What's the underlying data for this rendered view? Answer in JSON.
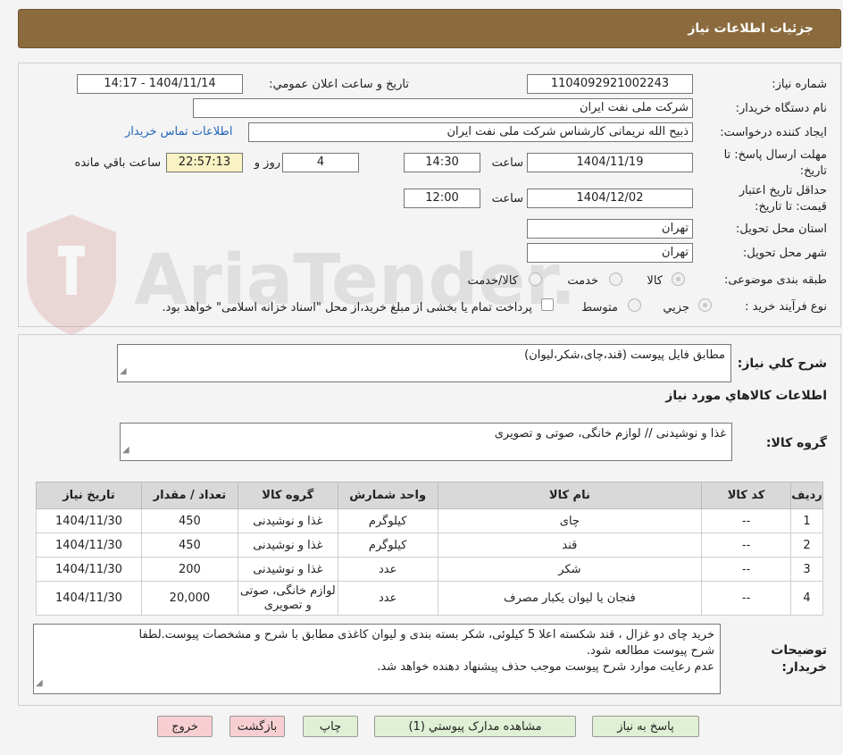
{
  "header": {
    "title": "جزئیات اطلاعات نیاز"
  },
  "watermark": {
    "text": "AriaTender.net"
  },
  "fields": {
    "need_number_label": "شماره نیاز:",
    "need_number": "1104092921002243",
    "announce_label": "تاریخ و ساعت اعلان عمومي:",
    "announce_value": "1404/11/14 - 14:17",
    "buyer_org_label": "نام دستگاه خريدار:",
    "buyer_org": "شرکت ملی نفت ایران",
    "creator_label": "ايجاد کننده درخواست:",
    "creator": "ذبیح الله نریمانی کارشناس شرکت ملی نفت ایران",
    "contact_link": "اطلاعات تماس خريدار",
    "reply_deadline_label_1": "مهلت ارسال پاسخ: تا",
    "reply_deadline_label_2": "تاریخ:",
    "reply_date": "1404/11/19",
    "time_label": "ساعت",
    "reply_time": "14:30",
    "days_value": "4",
    "days_label": "روز و",
    "remaining_time": "22:57:13",
    "remaining_label": "ساعت باقي مانده",
    "price_valid_label_1": "حداقل تاریخ اعتبار",
    "price_valid_label_2": "قیمت: تا تاریخ:",
    "price_valid_date": "1404/12/02",
    "price_valid_time": "12:00",
    "province_label": "استان محل تحویل:",
    "province": "تهران",
    "city_label": "شهر محل تحویل:",
    "city": "تهران",
    "category_label": "طبقه بندی موضوعی:",
    "category_options": [
      "کالا",
      "خدمت",
      "کالا/خدمت"
    ],
    "category_selected": "کالا",
    "process_label": "نوع فرآیند خرید :",
    "process_options": [
      "جزيي",
      "متوسط"
    ],
    "process_selected": "جزيي",
    "payment_note": "پرداخت تمام یا بخشی از مبلغ خرید،از محل \"اسناد خزانه اسلامی\" خواهد بود."
  },
  "summary": {
    "label": "شرح کلي نياز:",
    "value": "مطابق فایل پیوست (قند،چای،شکر،لیوان)"
  },
  "goods_info_title": "اطلاعات کالاهاي مورد نياز",
  "goods_group": {
    "label": "گروه کالا:",
    "value": "غذا و نوشیدنی // لوازم خانگی، صوتی و تصویری"
  },
  "table": {
    "headers": [
      "رديف",
      "کد کالا",
      "نام کالا",
      "واحد شمارش",
      "گروه کالا",
      "تعداد / مقدار",
      "تاریخ نیاز"
    ],
    "rows": [
      [
        "1",
        "--",
        "چای",
        "کیلوگرم",
        "غذا و نوشیدنی",
        "450",
        "1404/11/30"
      ],
      [
        "2",
        "--",
        "قند",
        "کیلوگرم",
        "غذا و نوشیدنی",
        "450",
        "1404/11/30"
      ],
      [
        "3",
        "--",
        "شکر",
        "عدد",
        "غذا و نوشیدنی",
        "200",
        "1404/11/30"
      ],
      [
        "4",
        "--",
        "فنجان یا لیوان یکبار مصرف",
        "عدد",
        "لوازم خانگی، صوتی و تصویری",
        "20,000",
        "1404/11/30"
      ]
    ]
  },
  "buyer_notes": {
    "label_1": "توضیحات",
    "label_2": "خریدار:",
    "lines": [
      "خرید چای دو غزال ، قند شکسته اعلا 5 کیلوئی، شکر بسته بندی و لیوان کاغذی مطابق با شرح و مشخصات  پیوست.لطفا",
      "شرح پیوست مطالعه شود.",
      "عدم رعایت موارد شرح پیوست موجب حذف پیشنهاد دهنده خواهد شد."
    ]
  },
  "buttons": {
    "reply": "پاسخ به نياز",
    "attachments": "مشاهده مدارک پيوستي (1)",
    "print": "چاپ",
    "back": "بازگشت",
    "exit": "خروج"
  }
}
